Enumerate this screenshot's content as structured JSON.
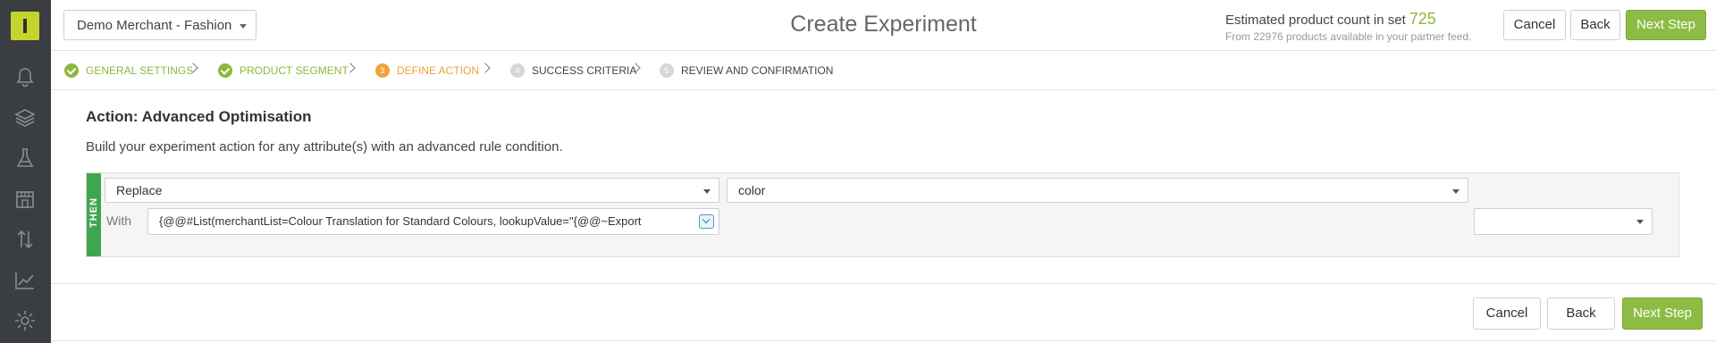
{
  "header": {
    "merchant": "Demo Merchant - Fashion",
    "title": "Create Experiment",
    "count_label": "Estimated product count in set",
    "count_value": "725",
    "count_sub": "From 22976 products available in your partner feed.",
    "cancel": "Cancel",
    "back": "Back",
    "next": "Next Step"
  },
  "steps": [
    {
      "label": "GENERAL SETTINGS",
      "status": "done"
    },
    {
      "label": "PRODUCT SEGMENT",
      "status": "done"
    },
    {
      "label": "DEFINE ACTION",
      "number": "3",
      "status": "active"
    },
    {
      "label": "SUCCESS CRITERIA",
      "number": "4",
      "status": "todo"
    },
    {
      "label": "REVIEW AND CONFIRMATION",
      "number": "5",
      "status": "todo"
    }
  ],
  "main": {
    "title": "Action: Advanced Optimisation",
    "description": "Build your experiment action for any attribute(s) with an advanced rule condition.",
    "then_label": "THEN",
    "operation": "Replace",
    "attribute": "color",
    "with_label": "With",
    "with_value": "{@@#List(merchantList=Colour Translation for Standard Colours, lookupValue=\"{@@~Export",
    "extra_select": ""
  },
  "footer": {
    "cancel": "Cancel",
    "back": "Back",
    "next": "Next Step"
  },
  "colors": {
    "sidebar": "#3a3d42",
    "logo": "#c5d42d",
    "primary": "#8cbc45",
    "done": "#8cb83d",
    "active": "#f0a23a",
    "then": "#3fa64f"
  }
}
